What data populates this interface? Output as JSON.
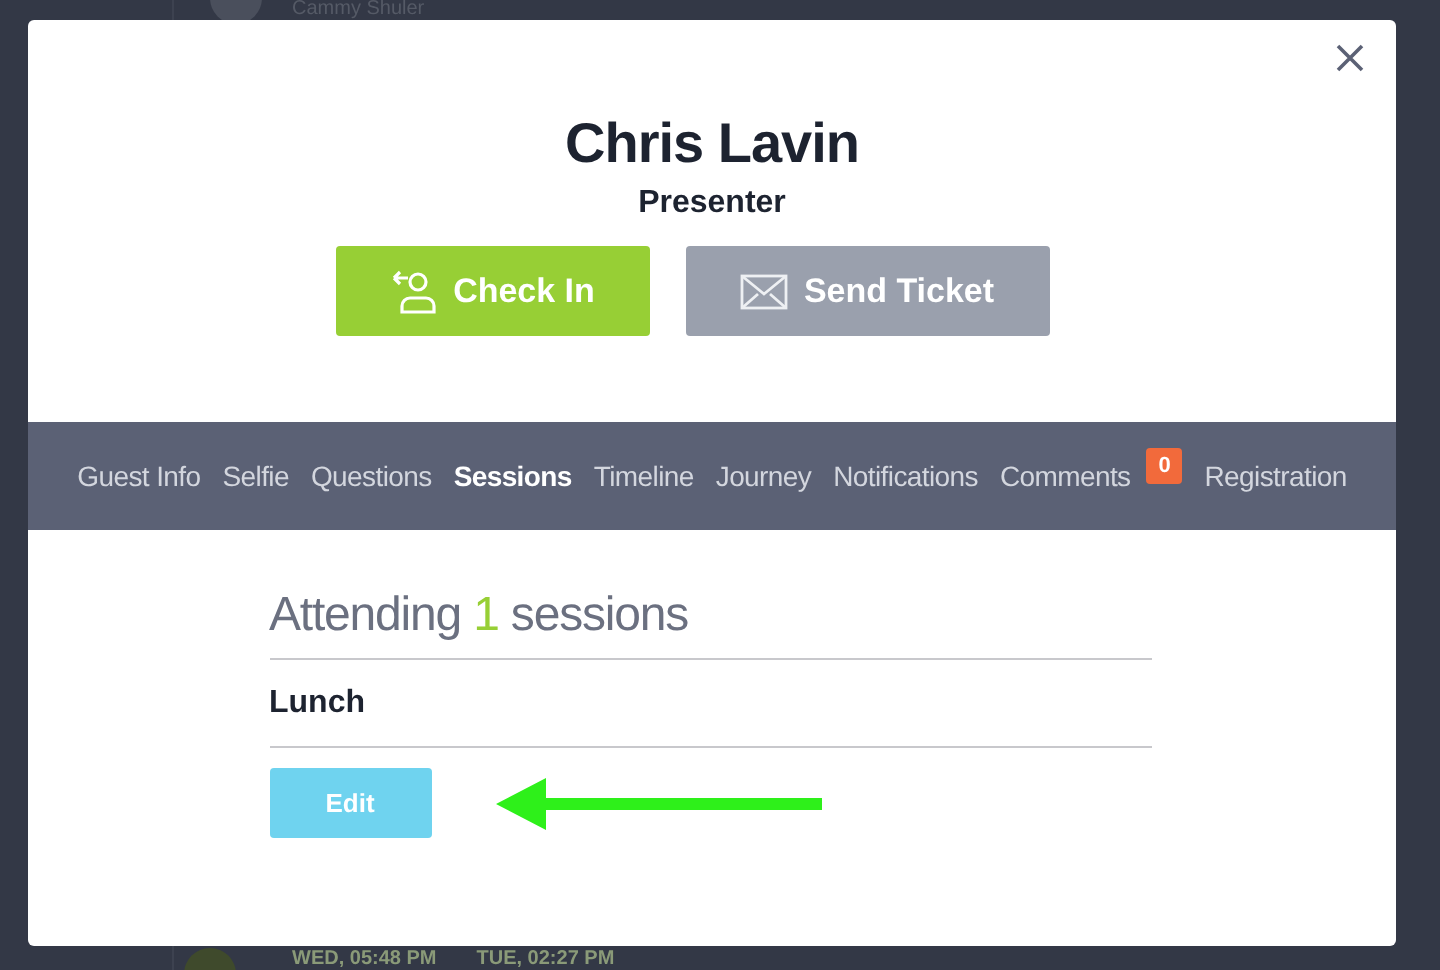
{
  "background": {
    "top_name": "Cammy Shuler",
    "bottom_times": [
      "WED, 05:48 PM",
      "TUE, 02:27 PM"
    ]
  },
  "modal": {
    "name": "Chris Lavin",
    "role": "Presenter",
    "actions": [
      {
        "kind": "check-in",
        "label": "Check In"
      },
      {
        "kind": "send-ticket",
        "label": "Send Ticket"
      }
    ],
    "tabs": [
      {
        "label": "Guest Info",
        "selected": false
      },
      {
        "label": "Selfie",
        "selected": false
      },
      {
        "label": "Questions",
        "selected": false
      },
      {
        "label": "Sessions",
        "selected": true
      },
      {
        "label": "Timeline",
        "selected": false
      },
      {
        "label": "Journey",
        "selected": false
      },
      {
        "label": "Notifications",
        "selected": false
      },
      {
        "label": "Comments",
        "selected": false,
        "badge": "0"
      },
      {
        "label": "Registration",
        "selected": false
      }
    ],
    "sessions": {
      "heading_prefix": "Attending",
      "count": "1",
      "heading_suffix": "sessions",
      "items": [
        "Lunch"
      ],
      "edit_button": "Edit"
    }
  }
}
